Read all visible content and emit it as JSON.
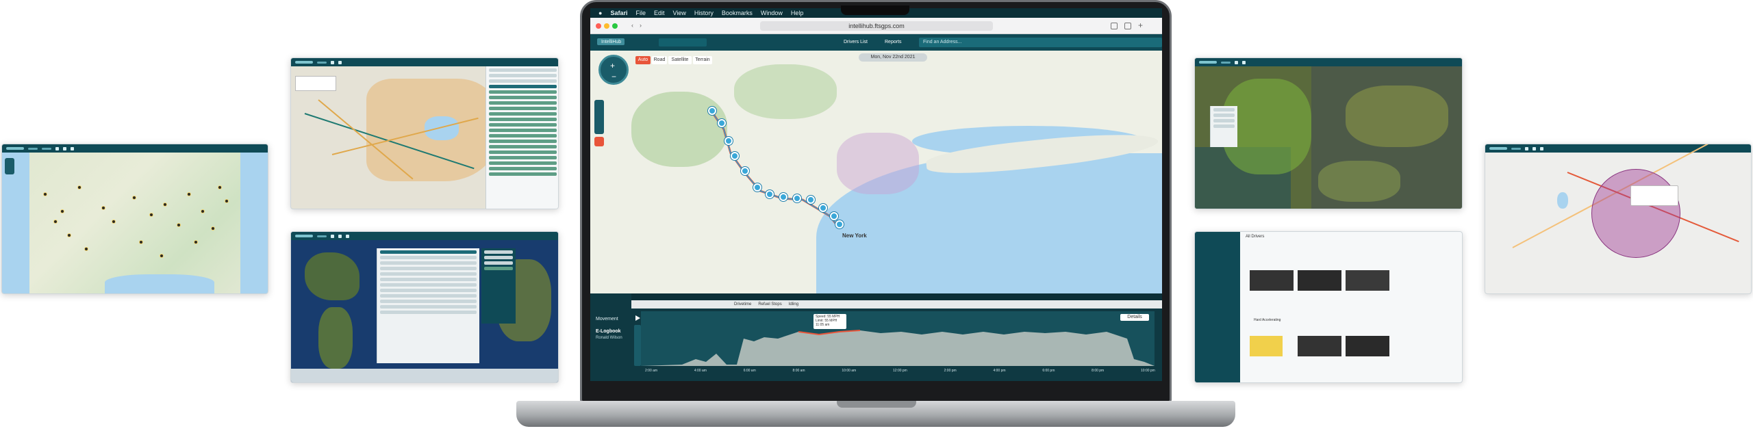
{
  "mac_menu": {
    "apple": "",
    "items": [
      "Safari",
      "File",
      "Edit",
      "View",
      "History",
      "Bookmarks",
      "Window",
      "Help"
    ]
  },
  "browser": {
    "url": "intellihub.ftsgps.com"
  },
  "app": {
    "brand": "IntelliHub",
    "drivers_list": "Drivers List",
    "reports": "Reports",
    "search_placeholder": "Find an Address...",
    "date_nav": "Mon, Nov 22nd 2021",
    "map_types": [
      "Auto",
      "Road",
      "Satellite",
      "Terrain"
    ],
    "city_label": "New York",
    "bottom": {
      "movement": "Movement",
      "elogbook": "E-Logbook",
      "driver": "Ronald Wilson",
      "legend": [
        "Drivetime",
        "Refuel Stops",
        "Idling"
      ],
      "tooltip": [
        "Speed: 55 MPH",
        "Limit: 55 MPH",
        "11:05 am"
      ],
      "details_button": "Details",
      "time_labels": [
        "2:00 am",
        "4:00 am",
        "6:00 am",
        "8:00 am",
        "10:00 am",
        "12:00 pm",
        "2:00 pm",
        "4:00 pm",
        "6:00 pm",
        "8:00 pm",
        "10:00 pm"
      ]
    }
  },
  "right_panel": {
    "title": "All Drivers",
    "incident": "Hard Accelerating"
  },
  "colors": {
    "teal_dark": "#0f4a56",
    "teal_mid": "#1a5c69",
    "route_blue": "#2a9fd6",
    "accent_orange": "#e8553a",
    "chart_fill": "#a9b7b4"
  }
}
